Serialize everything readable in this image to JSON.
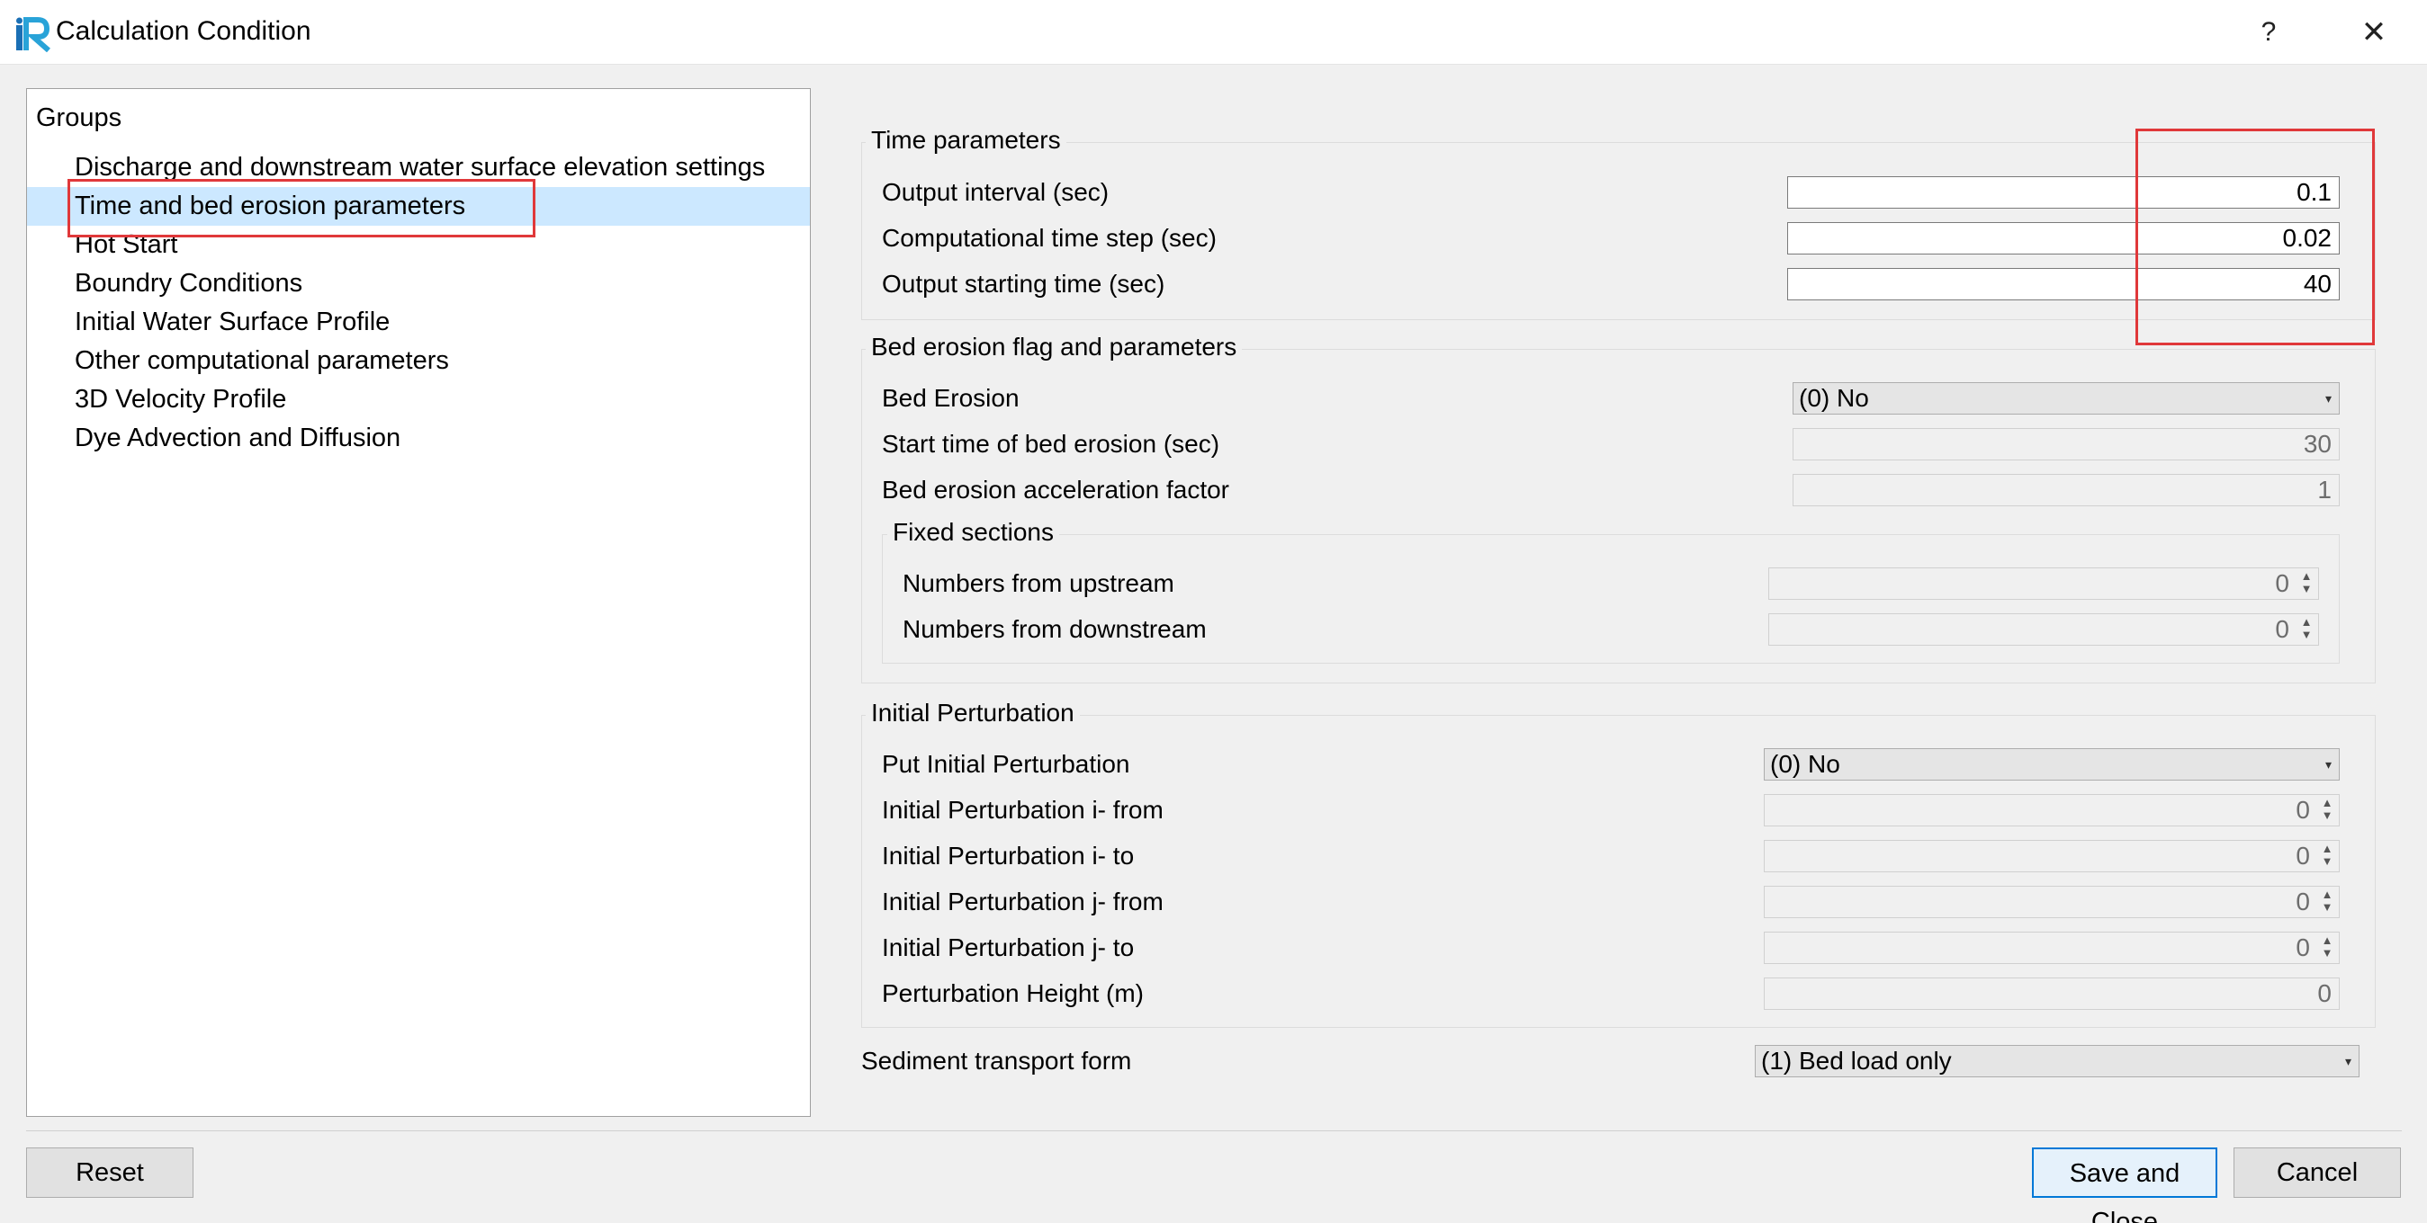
{
  "window": {
    "title": "Calculation Condition",
    "help_label": "?",
    "close_label": "✕"
  },
  "groups": {
    "header": "Groups",
    "items": [
      "Discharge and downstream water surface elevation settings",
      "Time and bed erosion parameters",
      "Hot Start",
      "Boundry Conditions",
      "Initial Water Surface Profile",
      "Other computational parameters",
      "3D Velocity Profile",
      "Dye Advection and Diffusion"
    ],
    "selected": "Time and bed erosion parameters"
  },
  "time_parameters": {
    "title": "Time parameters",
    "output_interval_label": "Output interval (sec)",
    "output_interval_value": "0.1",
    "time_step_label": "Computational time step (sec)",
    "time_step_value": "0.02",
    "start_time_label": "Output starting time (sec)",
    "start_time_value": "40"
  },
  "bed_erosion": {
    "title": "Bed erosion flag and parameters",
    "bed_erosion_label": "Bed Erosion",
    "bed_erosion_value": "(0) No",
    "start_time_label": "Start time of bed erosion (sec)",
    "start_time_value": "30",
    "acceleration_label": "Bed erosion acceleration factor",
    "acceleration_value": "1",
    "fixed_sections": {
      "title": "Fixed sections",
      "upstream_label": "Numbers from upstream",
      "upstream_value": "0",
      "downstream_label": "Numbers from downstream",
      "downstream_value": "0"
    }
  },
  "perturbation": {
    "title": "Initial Perturbation",
    "put_label": "Put Initial Perturbation",
    "put_value": "(0) No",
    "i_from_label": "Initial Perturbation i- from",
    "i_from_value": "0",
    "i_to_label": "Initial Perturbation i- to",
    "i_to_value": "0",
    "j_from_label": "Initial Perturbation j- from",
    "j_from_value": "0",
    "j_to_label": "Initial Perturbation j- to",
    "j_to_value": "0",
    "height_label": "Perturbation Height (m)",
    "height_value": "0"
  },
  "sediment": {
    "label": "Sediment transport form",
    "value": "(1) Bed load only"
  },
  "buttons": {
    "reset": "Reset",
    "save_close": "Save and Close",
    "cancel": "Cancel"
  },
  "colors": {
    "selection": "#cce8ff",
    "annotation_red": "#e0383a",
    "primary_border": "#0078d7"
  },
  "icons": {
    "spin": "spin-arrows-icon",
    "dropdown": "dropdown-arrow-icon",
    "logo": "iric-logo-icon"
  }
}
